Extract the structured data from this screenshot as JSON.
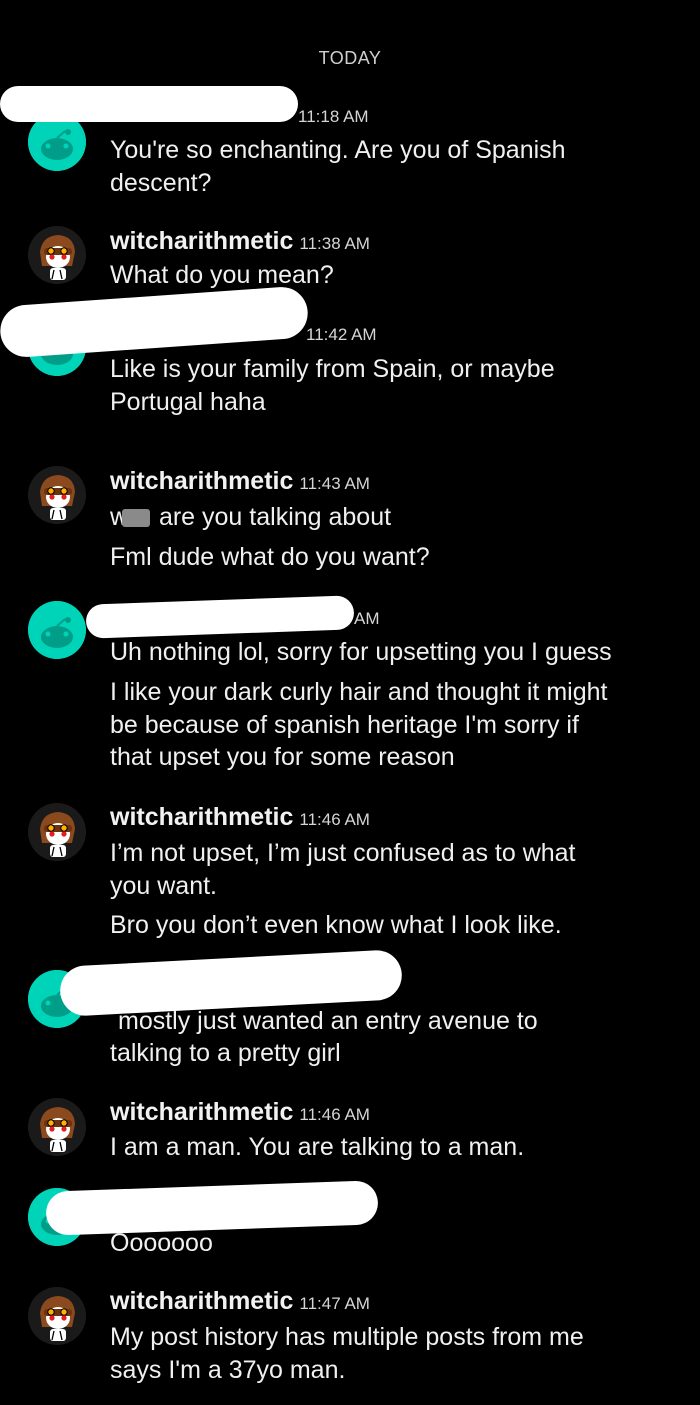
{
  "header": {
    "day_label": "TODAY"
  },
  "colors": {
    "background": "#000000",
    "other_avatar": "#00d4b8",
    "redaction": "#ffffff"
  },
  "messages": [
    {
      "sender": "other",
      "avatar_icon": "reddit-snoo-icon",
      "time": "11:18 AM",
      "lines": [
        "You're so enchanting. Are you of Spanish",
        "descent?"
      ]
    },
    {
      "sender": "witcharithmetic",
      "username": "witcharithmetic",
      "avatar_icon": "user-avatar-icon",
      "time": "11:38 AM",
      "lines": [
        "What do you mean?"
      ]
    },
    {
      "sender": "other",
      "avatar_icon": "reddit-snoo-icon",
      "time": "11:42 AM",
      "lines": [
        "Like is your family from Spain, or maybe",
        "Portugal haha"
      ]
    },
    {
      "sender": "witcharithmetic",
      "username": "witcharithmetic",
      "avatar_icon": "user-avatar-icon",
      "time": "11:43 AM",
      "lines": [
        "are you talking about",
        "Fml dude what do you want?"
      ]
    },
    {
      "sender": "other",
      "avatar_icon": "reddit-snoo-icon",
      "time": "AM",
      "lines": [
        "Uh nothing lol, sorry for upsetting you I guess",
        "I like your dark curly hair and thought it might",
        "be because of spanish heritage I'm sorry if",
        "that upset you for some reason"
      ]
    },
    {
      "sender": "witcharithmetic",
      "username": "witcharithmetic",
      "avatar_icon": "user-avatar-icon",
      "time": "11:46 AM",
      "lines": [
        "I’m not upset, I’m just confused as to what",
        "you want.",
        "Bro you don’t  even know what I look like."
      ]
    },
    {
      "sender": "other",
      "avatar_icon": "reddit-snoo-icon",
      "lines": [
        "mostly just wanted an entry avenue to",
        "talking to a pretty girl"
      ]
    },
    {
      "sender": "witcharithmetic",
      "username": "witcharithmetic",
      "avatar_icon": "user-avatar-icon",
      "time": "11:46 AM",
      "lines": [
        "I am a man. You are talking to a man."
      ]
    },
    {
      "sender": "other",
      "avatar_icon": "reddit-snoo-icon",
      "lines": [
        "Ooooooo"
      ]
    },
    {
      "sender": "witcharithmetic",
      "username": "witcharithmetic",
      "avatar_icon": "user-avatar-icon",
      "time": "11:47 AM",
      "lines": [
        "My post history has multiple posts from me",
        "says I'm a 37yo man."
      ]
    }
  ]
}
